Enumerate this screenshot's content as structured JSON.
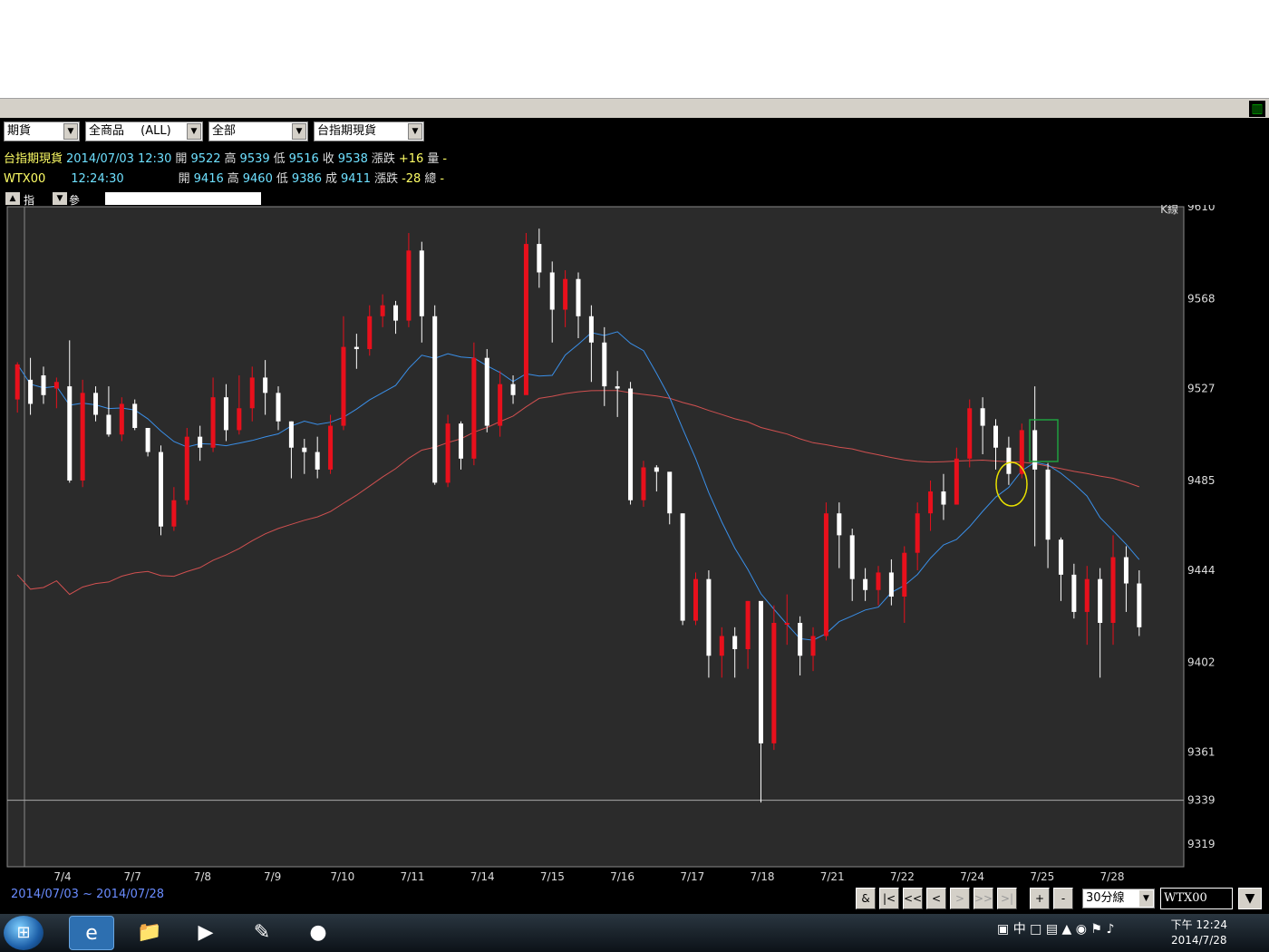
{
  "toolbar": {
    "market": "期貨",
    "product": "全商品",
    "product_suffix": "(ALL)",
    "scope": "全部",
    "symbol_name": "台指期現貨"
  },
  "quotes": [
    {
      "name": "台指期現貨",
      "date": "2014/07/03",
      "time": "12:30",
      "open_label": "開",
      "open": "9522",
      "high_label": "高",
      "high": "9539",
      "low_label": "低",
      "low": "9516",
      "close_label": "收",
      "close": "9538",
      "chg_label": "漲跌",
      "chg": "+16",
      "vol_label": "量",
      "vol": "-"
    },
    {
      "name": "WTX00",
      "date": "",
      "time": "12:24:30",
      "open_label": "開",
      "open": "9416",
      "high_label": "高",
      "high": "9460",
      "low_label": "低",
      "low": "9386",
      "close_label": "成",
      "close": "9411",
      "chg_label": "漲跌",
      "chg": "-28",
      "vol_label": "總",
      "vol": "-"
    }
  ],
  "tabs": {
    "indicator": "指標",
    "params": "參數"
  },
  "chart_label": "K線",
  "range": {
    "from": "2014/07/03",
    "sep": "~",
    "to": "2014/07/28"
  },
  "nav": {
    "amp": "&",
    "first": "|<",
    "prev_page": "<<",
    "prev": "<",
    "next": ">",
    "next_page": ">>",
    "last": ">|",
    "zoom_in": "+",
    "zoom_out": "-"
  },
  "period": "30分線",
  "code": "WTX00",
  "taskbar": {
    "ime": "中",
    "clock_time": "下午 12:24",
    "clock_date": "2014/7/28"
  },
  "colors": {
    "up": "#e8101c",
    "down": "#ffffff",
    "ma_short": "#3a8fe8",
    "ma_long": "#d05050",
    "bg": "#2b2b2b"
  },
  "chart_data": {
    "type": "candlestick",
    "y_ticks": [
      9610,
      9568,
      9527,
      9485,
      9444,
      9402,
      9361,
      9339,
      9319
    ],
    "ylim": [
      9319,
      9610
    ],
    "x_ticks": [
      "7/4",
      "7/7",
      "7/8",
      "7/9",
      "7/10",
      "7/11",
      "7/14",
      "7/15",
      "7/16",
      "7/17",
      "7/18",
      "7/21",
      "7/22",
      "7/24",
      "7/25",
      "7/28"
    ],
    "candles": [
      [
        9522,
        9538,
        9516,
        9539
      ],
      [
        9531,
        9520,
        9515,
        9541
      ],
      [
        9533,
        9524,
        9520,
        9537
      ],
      [
        9527,
        9530,
        9518,
        9532
      ],
      [
        9528,
        9485,
        9484,
        9549
      ],
      [
        9485,
        9525,
        9482,
        9531
      ],
      [
        9525,
        9515,
        9512,
        9528
      ],
      [
        9515,
        9506,
        9505,
        9528
      ],
      [
        9506,
        9520,
        9503,
        9523
      ],
      [
        9520,
        9509,
        9508,
        9522
      ],
      [
        9509,
        9498,
        9496,
        9500
      ],
      [
        9498,
        9464,
        9460,
        9501
      ],
      [
        9464,
        9476,
        9462,
        9482
      ],
      [
        9476,
        9505,
        9474,
        9509
      ],
      [
        9505,
        9500,
        9494,
        9510
      ],
      [
        9500,
        9523,
        9498,
        9532
      ],
      [
        9523,
        9508,
        9503,
        9529
      ],
      [
        9508,
        9518,
        9506,
        9533
      ],
      [
        9518,
        9532,
        9512,
        9537
      ],
      [
        9532,
        9525,
        9515,
        9540
      ],
      [
        9525,
        9512,
        9508,
        9528
      ],
      [
        9512,
        9500,
        9486,
        9512
      ],
      [
        9500,
        9498,
        9488,
        9504
      ],
      [
        9498,
        9490,
        9486,
        9505
      ],
      [
        9490,
        9510,
        9488,
        9515
      ],
      [
        9510,
        9546,
        9508,
        9560
      ],
      [
        9546,
        9545,
        9536,
        9552
      ],
      [
        9545,
        9560,
        9542,
        9565
      ],
      [
        9560,
        9565,
        9555,
        9570
      ],
      [
        9565,
        9558,
        9552,
        9567
      ],
      [
        9558,
        9590,
        9555,
        9598
      ],
      [
        9590,
        9560,
        9548,
        9594
      ],
      [
        9560,
        9484,
        9483,
        9565
      ],
      [
        9484,
        9511,
        9482,
        9515
      ],
      [
        9511,
        9495,
        9490,
        9512
      ],
      [
        9495,
        9541,
        9492,
        9548
      ],
      [
        9541,
        9510,
        9507,
        9545
      ],
      [
        9510,
        9529,
        9505,
        9535
      ],
      [
        9529,
        9524,
        9520,
        9533
      ],
      [
        9524,
        9593,
        9560,
        9598
      ],
      [
        9593,
        9580,
        9573,
        9600
      ],
      [
        9580,
        9563,
        9548,
        9585
      ],
      [
        9563,
        9577,
        9555,
        9581
      ],
      [
        9577,
        9560,
        9550,
        9580
      ],
      [
        9560,
        9548,
        9530,
        9565
      ],
      [
        9548,
        9528,
        9519,
        9555
      ],
      [
        9528,
        9527,
        9514,
        9535
      ],
      [
        9527,
        9476,
        9474,
        9530
      ],
      [
        9476,
        9491,
        9473,
        9494
      ],
      [
        9491,
        9489,
        9480,
        9492
      ],
      [
        9489,
        9470,
        9465,
        9471
      ],
      [
        9470,
        9421,
        9419,
        9470
      ],
      [
        9421,
        9440,
        9419,
        9443
      ],
      [
        9440,
        9405,
        9395,
        9444
      ],
      [
        9405,
        9414,
        9395,
        9418
      ],
      [
        9414,
        9408,
        9395,
        9418
      ],
      [
        9408,
        9430,
        9399,
        9430
      ],
      [
        9430,
        9365,
        9338,
        9402
      ],
      [
        9365,
        9420,
        9362,
        9428
      ],
      [
        9420,
        9420,
        9410,
        9433
      ],
      [
        9420,
        9405,
        9396,
        9423
      ],
      [
        9405,
        9414,
        9398,
        9418
      ],
      [
        9414,
        9470,
        9412,
        9475
      ],
      [
        9470,
        9460,
        9445,
        9475
      ],
      [
        9460,
        9440,
        9430,
        9463
      ],
      [
        9440,
        9435,
        9430,
        9445
      ],
      [
        9435,
        9443,
        9428,
        9446
      ],
      [
        9443,
        9432,
        9428,
        9449
      ],
      [
        9432,
        9452,
        9420,
        9455
      ],
      [
        9452,
        9470,
        9444,
        9475
      ],
      [
        9470,
        9480,
        9462,
        9485
      ],
      [
        9480,
        9474,
        9467,
        9488
      ],
      [
        9474,
        9495,
        9474,
        9500
      ],
      [
        9495,
        9518,
        9491,
        9522
      ],
      [
        9518,
        9510,
        9497,
        9523
      ],
      [
        9510,
        9500,
        9490,
        9513
      ],
      [
        9500,
        9488,
        9483,
        9505
      ],
      [
        9488,
        9508,
        9486,
        9511
      ],
      [
        9508,
        9490,
        9455,
        9528
      ],
      [
        9490,
        9458,
        9445,
        9493
      ],
      [
        9458,
        9442,
        9430,
        9459
      ],
      [
        9442,
        9425,
        9422,
        9447
      ],
      [
        9425,
        9440,
        9410,
        9446
      ],
      [
        9440,
        9420,
        9395,
        9445
      ],
      [
        9420,
        9450,
        9410,
        9460
      ],
      [
        9450,
        9438,
        9425,
        9455
      ],
      [
        9438,
        9418,
        9414,
        9444
      ]
    ]
  }
}
